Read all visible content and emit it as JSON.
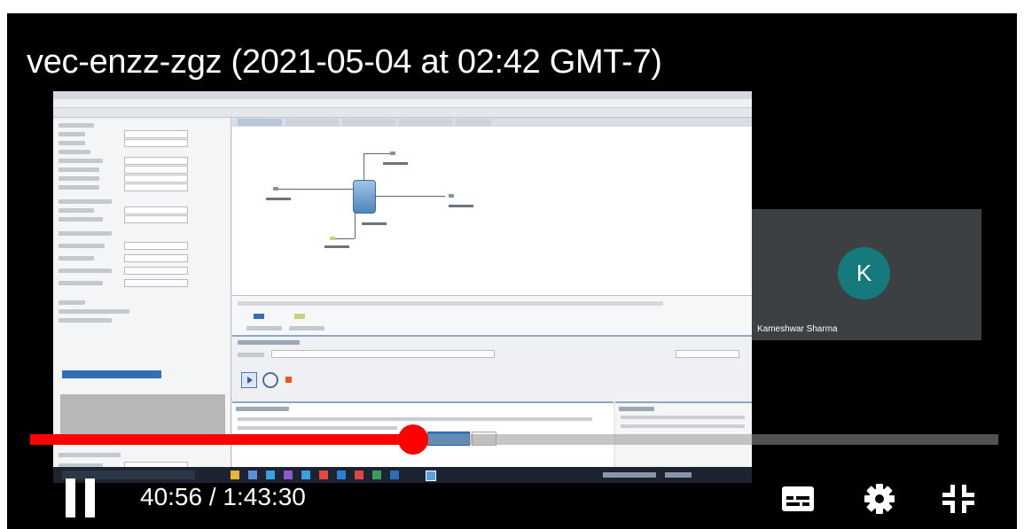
{
  "video": {
    "title": "vec-enzz-zgz (2021-05-04 at 02:42 GMT-7)",
    "current_time": "40:56",
    "separator": " / ",
    "duration": "1:43:30",
    "progress_fraction": 0.396
  },
  "participant": {
    "initial": "K",
    "name": "Kameshwar Sharma",
    "avatar_color": "#167a7c"
  },
  "controls": {
    "play_state_icon": "pause-icon",
    "subtitles_icon": "subtitles-icon",
    "settings_icon": "gear-icon",
    "exit_fullscreen_icon": "exit-fullscreen-icon"
  },
  "colors": {
    "progress": "#ff0000",
    "background": "#000000"
  }
}
